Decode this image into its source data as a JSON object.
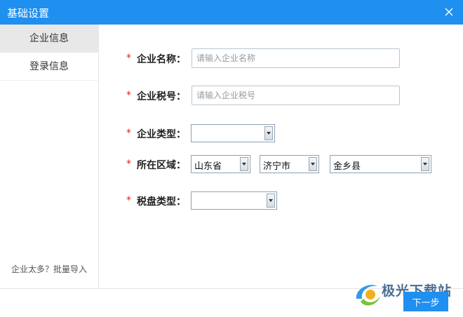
{
  "window": {
    "title": "基础设置",
    "close_icon": "close-icon"
  },
  "sidebar": {
    "items": [
      {
        "label": "企业信息",
        "active": true
      },
      {
        "label": "登录信息",
        "active": false
      }
    ],
    "bulk_import_link": "企业太多？批量导入"
  },
  "form": {
    "required_mark": "*",
    "company_name": {
      "label": "企业名称：",
      "value": "",
      "placeholder": "请输入企业名称"
    },
    "tax_number": {
      "label": "企业税号：",
      "value": "",
      "placeholder": "请输入企业税号"
    },
    "company_type": {
      "label": "企业类型：",
      "selected": ""
    },
    "region": {
      "label": "所在区域：",
      "province": "山东省",
      "city": "济宁市",
      "county": "金乡县"
    },
    "tax_disk_type": {
      "label": "税盘类型：",
      "selected": ""
    }
  },
  "footer": {
    "next_button": "下一步"
  },
  "watermark": {
    "text": "极光下载站"
  },
  "colors": {
    "accent": "#1f8ff0",
    "required": "#e02020",
    "sidebar_active": "#e8e8e8"
  }
}
